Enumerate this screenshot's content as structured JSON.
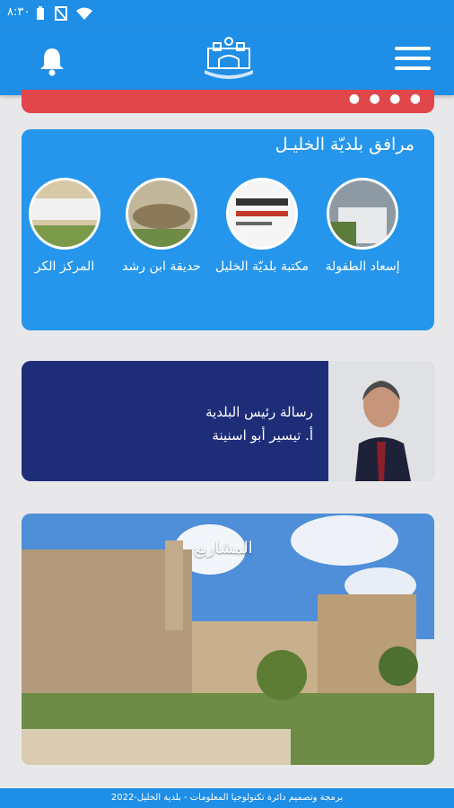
{
  "status_bar": {
    "time": "٨:٣٠"
  },
  "icons": {
    "bell": "bell-icon",
    "menu": "menu-icon",
    "logo": "municipality-logo"
  },
  "facilities": {
    "title": "مرافق بلديّة الخليـل",
    "items": [
      {
        "label": "إسعاد الطفولة"
      },
      {
        "label": "مكتبة بلديّة الخليل"
      },
      {
        "label": "حديقة ابن رشد"
      },
      {
        "label": "المركز الكر"
      }
    ]
  },
  "mayor_message": {
    "title": "رسالة رئيس البلدية",
    "name": "أ. تيسير أبو اسنينة"
  },
  "projects": {
    "label": "المشاريع"
  },
  "footer": {
    "text": "برمجة وتصميم دائرة تكنولوجيا المعلومات - بلدية الخليل-2022"
  },
  "colors": {
    "primary": "#1e8ee6",
    "facilities_bg": "#2596ec",
    "mayor_bg": "#1e2d78",
    "banner": "#e0464a"
  }
}
